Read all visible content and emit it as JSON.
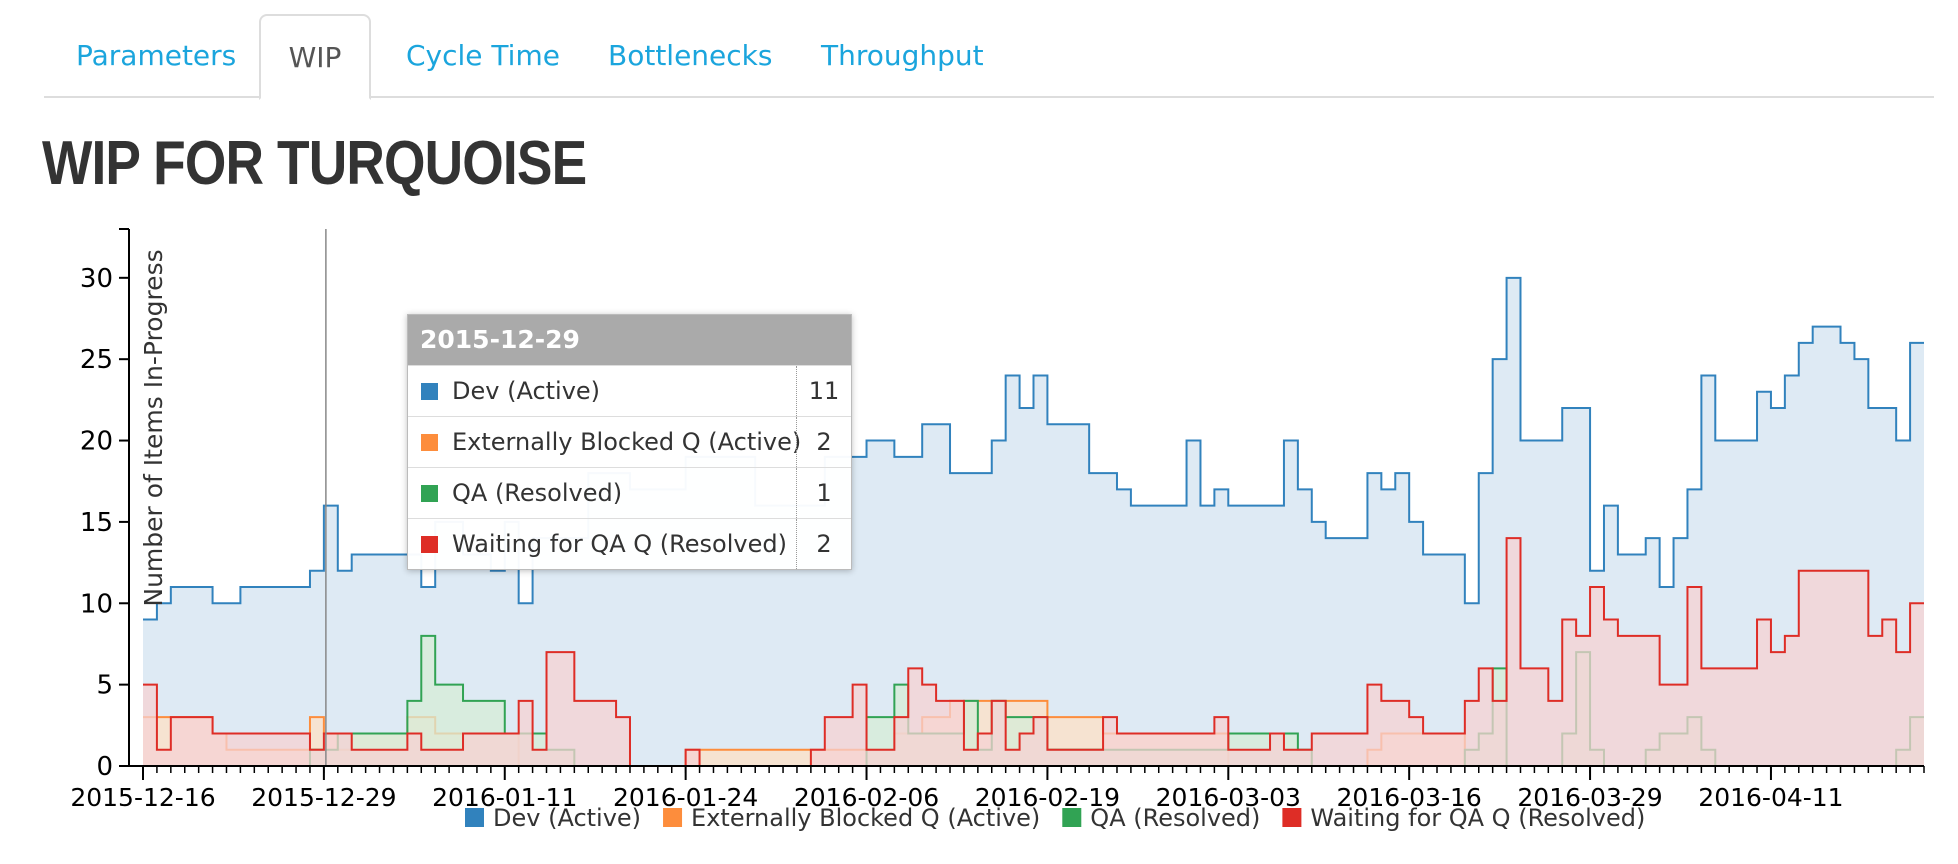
{
  "tabs": [
    {
      "label": "Parameters",
      "active": false
    },
    {
      "label": "WIP",
      "active": true
    },
    {
      "label": "Cycle Time",
      "active": false
    },
    {
      "label": "Bottlenecks",
      "active": false
    },
    {
      "label": "Throughput",
      "active": false
    }
  ],
  "page_title": "WIP FOR TURQUOISE",
  "tooltip": {
    "date": "2015-12-29",
    "rows": [
      {
        "name": "Dev (Active)",
        "value": "11",
        "color": "#3182bd"
      },
      {
        "name": "Externally Blocked Q (Active)",
        "value": "2",
        "color": "#fd8d3c"
      },
      {
        "name": "QA (Resolved)",
        "value": "1",
        "color": "#31a354"
      },
      {
        "name": "Waiting for QA Q (Resolved)",
        "value": "2",
        "color": "#de2d26"
      }
    ]
  },
  "chart_data": {
    "type": "area",
    "ylabel": "Number of Items In-Progress",
    "ylim": [
      0,
      33
    ],
    "y_ticks": [
      0,
      5,
      10,
      15,
      20,
      25,
      30
    ],
    "x_ticks": [
      "2015-12-16",
      "2015-12-29",
      "2016-01-11",
      "2016-01-24",
      "2016-02-06",
      "2016-02-19",
      "2016-03-03",
      "2016-03-16",
      "2016-03-29",
      "2016-04-11"
    ],
    "x_range": [
      "2015-12-16",
      "2016-04-21"
    ],
    "hover_date": "2015-12-29",
    "step": true,
    "legend_position": "bottom",
    "series": [
      {
        "name": "Dev (Active)",
        "color": "#3182bd",
        "fill": "#d3e3f0",
        "points": [
          [
            "2015-12-16",
            9
          ],
          [
            "2015-12-17",
            10
          ],
          [
            "2015-12-18",
            11
          ],
          [
            "2015-12-21",
            10
          ],
          [
            "2015-12-23",
            11
          ],
          [
            "2015-12-28",
            12
          ],
          [
            "2015-12-29",
            16
          ],
          [
            "2015-12-30",
            12
          ],
          [
            "2015-12-31",
            13
          ],
          [
            "2016-01-03",
            13
          ],
          [
            "2016-01-05",
            11
          ],
          [
            "2016-01-06",
            15
          ],
          [
            "2016-01-08",
            13
          ],
          [
            "2016-01-10",
            12
          ],
          [
            "2016-01-11",
            15
          ],
          [
            "2016-01-12",
            10
          ],
          [
            "2016-01-13",
            14
          ],
          [
            "2016-01-17",
            18
          ],
          [
            "2016-01-20",
            17
          ],
          [
            "2016-01-24",
            19
          ],
          [
            "2016-01-29",
            16
          ],
          [
            "2016-02-03",
            19
          ],
          [
            "2016-02-06",
            20
          ],
          [
            "2016-02-08",
            19
          ],
          [
            "2016-02-10",
            21
          ],
          [
            "2016-02-12",
            18
          ],
          [
            "2016-02-15",
            20
          ],
          [
            "2016-02-16",
            24
          ],
          [
            "2016-02-17",
            22
          ],
          [
            "2016-02-18",
            24
          ],
          [
            "2016-02-19",
            21
          ],
          [
            "2016-02-22",
            18
          ],
          [
            "2016-02-24",
            17
          ],
          [
            "2016-02-25",
            16
          ],
          [
            "2016-02-29",
            20
          ],
          [
            "2016-03-01",
            16
          ],
          [
            "2016-03-02",
            17
          ],
          [
            "2016-03-03",
            16
          ],
          [
            "2016-03-07",
            20
          ],
          [
            "2016-03-08",
            17
          ],
          [
            "2016-03-09",
            15
          ],
          [
            "2016-03-10",
            14
          ],
          [
            "2016-03-13",
            18
          ],
          [
            "2016-03-14",
            17
          ],
          [
            "2016-03-15",
            18
          ],
          [
            "2016-03-16",
            15
          ],
          [
            "2016-03-17",
            13
          ],
          [
            "2016-03-20",
            10
          ],
          [
            "2016-03-21",
            18
          ],
          [
            "2016-03-22",
            25
          ],
          [
            "2016-03-23",
            30
          ],
          [
            "2016-03-24",
            20
          ],
          [
            "2016-03-27",
            22
          ],
          [
            "2016-03-29",
            12
          ],
          [
            "2016-03-30",
            16
          ],
          [
            "2016-03-31",
            13
          ],
          [
            "2016-04-02",
            14
          ],
          [
            "2016-04-03",
            11
          ],
          [
            "2016-04-04",
            14
          ],
          [
            "2016-04-05",
            17
          ],
          [
            "2016-04-06",
            24
          ],
          [
            "2016-04-07",
            20
          ],
          [
            "2016-04-10",
            23
          ],
          [
            "2016-04-11",
            22
          ],
          [
            "2016-04-12",
            24
          ],
          [
            "2016-04-13",
            26
          ],
          [
            "2016-04-14",
            27
          ],
          [
            "2016-04-16",
            26
          ],
          [
            "2016-04-17",
            25
          ],
          [
            "2016-04-18",
            22
          ],
          [
            "2016-04-20",
            20
          ],
          [
            "2016-04-21",
            26
          ]
        ]
      },
      {
        "name": "Externally Blocked Q (Active)",
        "color": "#fd8d3c",
        "fill": "#fde0c6",
        "points": [
          [
            "2015-12-16",
            3
          ],
          [
            "2015-12-21",
            2
          ],
          [
            "2015-12-22",
            1
          ],
          [
            "2015-12-28",
            3
          ],
          [
            "2015-12-29",
            2
          ],
          [
            "2015-12-30",
            1
          ],
          [
            "2015-12-31",
            2
          ],
          [
            "2016-01-04",
            3
          ],
          [
            "2016-01-06",
            2
          ],
          [
            "2016-01-12",
            0
          ],
          [
            "2016-01-24",
            1
          ],
          [
            "2016-02-08",
            2
          ],
          [
            "2016-02-10",
            3
          ],
          [
            "2016-02-12",
            4
          ],
          [
            "2016-02-19",
            3
          ],
          [
            "2016-02-23",
            2
          ],
          [
            "2016-02-24",
            2
          ],
          [
            "2016-03-03",
            0
          ],
          [
            "2016-03-13",
            1
          ],
          [
            "2016-03-14",
            2
          ],
          [
            "2016-03-20",
            0
          ]
        ]
      },
      {
        "name": "QA (Resolved)",
        "color": "#31a354",
        "fill": "#d5ecd7",
        "points": [
          [
            "2015-12-16",
            0
          ],
          [
            "2015-12-28",
            1
          ],
          [
            "2015-12-30",
            2
          ],
          [
            "2016-01-04",
            4
          ],
          [
            "2016-01-05",
            8
          ],
          [
            "2016-01-06",
            5
          ],
          [
            "2016-01-08",
            4
          ],
          [
            "2016-01-11",
            2
          ],
          [
            "2016-01-14",
            1
          ],
          [
            "2016-01-16",
            0
          ],
          [
            "2016-02-06",
            3
          ],
          [
            "2016-02-08",
            5
          ],
          [
            "2016-02-09",
            2
          ],
          [
            "2016-02-13",
            4
          ],
          [
            "2016-02-14",
            1
          ],
          [
            "2016-02-15",
            4
          ],
          [
            "2016-02-16",
            3
          ],
          [
            "2016-02-19",
            1
          ],
          [
            "2016-02-23",
            1
          ],
          [
            "2016-03-03",
            2
          ],
          [
            "2016-03-06",
            2
          ],
          [
            "2016-03-08",
            1
          ],
          [
            "2016-03-09",
            0
          ],
          [
            "2016-03-13",
            0
          ],
          [
            "2016-03-14",
            0
          ],
          [
            "2016-03-20",
            1
          ],
          [
            "2016-03-21",
            2
          ],
          [
            "2016-03-22",
            6
          ],
          [
            "2016-03-23",
            0
          ],
          [
            "2016-03-27",
            2
          ],
          [
            "2016-03-28",
            7
          ],
          [
            "2016-03-29",
            1
          ],
          [
            "2016-03-30",
            0
          ],
          [
            "2016-04-02",
            1
          ],
          [
            "2016-04-03",
            2
          ],
          [
            "2016-04-05",
            3
          ],
          [
            "2016-04-06",
            1
          ],
          [
            "2016-04-07",
            0
          ],
          [
            "2016-04-16",
            0
          ],
          [
            "2016-04-20",
            1
          ],
          [
            "2016-04-21",
            3
          ]
        ]
      },
      {
        "name": "Waiting for QA Q (Resolved)",
        "color": "#de2d26",
        "fill": "#f5d2d3",
        "points": [
          [
            "2015-12-16",
            5
          ],
          [
            "2015-12-17",
            1
          ],
          [
            "2015-12-18",
            3
          ],
          [
            "2015-12-21",
            2
          ],
          [
            "2015-12-23",
            2
          ],
          [
            "2015-12-28",
            1
          ],
          [
            "2015-12-29",
            2
          ],
          [
            "2015-12-31",
            1
          ],
          [
            "2016-01-04",
            2
          ],
          [
            "2016-01-05",
            1
          ],
          [
            "2016-01-06",
            1
          ],
          [
            "2016-01-08",
            2
          ],
          [
            "2016-01-11",
            2
          ],
          [
            "2016-01-12",
            4
          ],
          [
            "2016-01-13",
            1
          ],
          [
            "2016-01-14",
            7
          ],
          [
            "2016-01-16",
            4
          ],
          [
            "2016-01-18",
            4
          ],
          [
            "2016-01-19",
            3
          ],
          [
            "2016-01-20",
            0
          ],
          [
            "2016-01-24",
            1
          ],
          [
            "2016-01-25",
            0
          ],
          [
            "2016-02-02",
            1
          ],
          [
            "2016-02-03",
            3
          ],
          [
            "2016-02-05",
            5
          ],
          [
            "2016-02-06",
            1
          ],
          [
            "2016-02-08",
            3
          ],
          [
            "2016-02-09",
            6
          ],
          [
            "2016-02-10",
            5
          ],
          [
            "2016-02-11",
            4
          ],
          [
            "2016-02-13",
            1
          ],
          [
            "2016-02-14",
            2
          ],
          [
            "2016-02-15",
            4
          ],
          [
            "2016-02-16",
            1
          ],
          [
            "2016-02-17",
            2
          ],
          [
            "2016-02-18",
            3
          ],
          [
            "2016-02-19",
            1
          ],
          [
            "2016-02-21",
            1
          ],
          [
            "2016-02-23",
            3
          ],
          [
            "2016-02-24",
            2
          ],
          [
            "2016-03-02",
            3
          ],
          [
            "2016-03-03",
            1
          ],
          [
            "2016-03-06",
            2
          ],
          [
            "2016-03-07",
            1
          ],
          [
            "2016-03-08",
            1
          ],
          [
            "2016-03-09",
            2
          ],
          [
            "2016-03-12",
            2
          ],
          [
            "2016-03-13",
            5
          ],
          [
            "2016-03-14",
            4
          ],
          [
            "2016-03-16",
            3
          ],
          [
            "2016-03-17",
            2
          ],
          [
            "2016-03-20",
            4
          ],
          [
            "2016-03-21",
            6
          ],
          [
            "2016-03-22",
            4
          ],
          [
            "2016-03-23",
            14
          ],
          [
            "2016-03-24",
            6
          ],
          [
            "2016-03-26",
            4
          ],
          [
            "2016-03-27",
            9
          ],
          [
            "2016-03-28",
            8
          ],
          [
            "2016-03-29",
            11
          ],
          [
            "2016-03-30",
            9
          ],
          [
            "2016-03-31",
            8
          ],
          [
            "2016-04-03",
            5
          ],
          [
            "2016-04-05",
            11
          ],
          [
            "2016-04-06",
            6
          ],
          [
            "2016-04-10",
            9
          ],
          [
            "2016-04-11",
            7
          ],
          [
            "2016-04-12",
            8
          ],
          [
            "2016-04-13",
            12
          ],
          [
            "2016-04-16",
            12
          ],
          [
            "2016-04-18",
            8
          ],
          [
            "2016-04-19",
            9
          ],
          [
            "2016-04-20",
            7
          ],
          [
            "2016-04-21",
            10
          ]
        ]
      }
    ]
  }
}
